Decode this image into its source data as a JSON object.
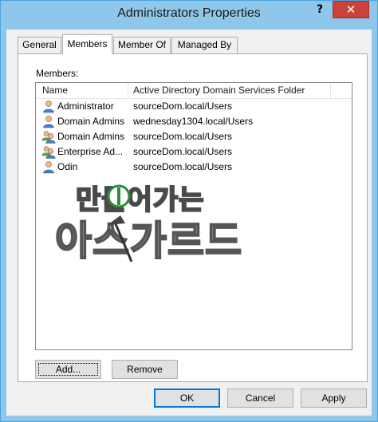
{
  "window": {
    "title": "Administrators Properties",
    "help_glyph": "?",
    "close_glyph": "✕"
  },
  "tabs": [
    {
      "label": "General",
      "active": false
    },
    {
      "label": "Members",
      "active": true
    },
    {
      "label": "Member Of",
      "active": false
    },
    {
      "label": "Managed By",
      "active": false
    }
  ],
  "members": {
    "label": "Members:",
    "columns": [
      "Name",
      "Active Directory Domain Services Folder"
    ],
    "rows": [
      {
        "icon": "user-icon",
        "name": "Administrator",
        "folder": "sourceDom.local/Users"
      },
      {
        "icon": "user-icon",
        "name": "Domain Admins",
        "folder": "wednesday1304.local/Users"
      },
      {
        "icon": "group-icon",
        "name": "Domain Admins",
        "folder": "sourceDom.local/Users"
      },
      {
        "icon": "group-icon",
        "name": "Enterprise Ad...",
        "folder": "sourceDom.local/Users"
      },
      {
        "icon": "user-icon",
        "name": "Odin",
        "folder": "sourceDom.local/Users"
      }
    ]
  },
  "watermark": {
    "line1": "만들어가는",
    "line2": "아스가르드"
  },
  "buttons": {
    "add": "Add...",
    "remove": "Remove",
    "ok": "OK",
    "cancel": "Cancel",
    "apply": "Apply"
  },
  "colors": {
    "titlebar": "#8ec7ea",
    "close": "#c9423b",
    "dialog_bg": "#f0f0f0",
    "focus_border": "#0078d7"
  }
}
